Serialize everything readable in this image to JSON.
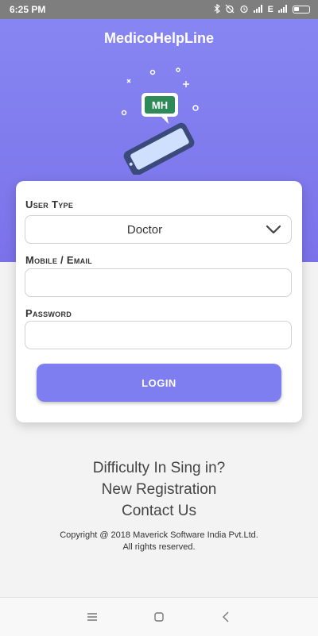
{
  "status_bar": {
    "time": "6:25 PM",
    "network_label": "E",
    "icons": [
      "bluetooth-icon",
      "alarm-off-icon",
      "alarm-icon",
      "signal-icon",
      "signal-icon",
      "battery-icon"
    ]
  },
  "app": {
    "title": "MedicoHelpLine",
    "logo_text": "MH",
    "accent_color": "#7e7ef0"
  },
  "form": {
    "user_type_label": "User Type",
    "user_type_value": "Doctor",
    "mobile_label": "Mobile / Email",
    "mobile_value": "",
    "password_label": "Password",
    "password_value": "",
    "login_label": "LOGIN"
  },
  "links": {
    "difficulty": "Difficulty In Sing in?",
    "registration": "New Registration",
    "contact": "Contact Us"
  },
  "footer": {
    "copyright_line1": "Copyright @ 2018 Maverick Software India Pvt.Ltd.",
    "copyright_line2": "All rights reserved."
  },
  "nav_bar": {
    "icons": [
      "menu-icon",
      "home-icon",
      "back-icon"
    ]
  }
}
